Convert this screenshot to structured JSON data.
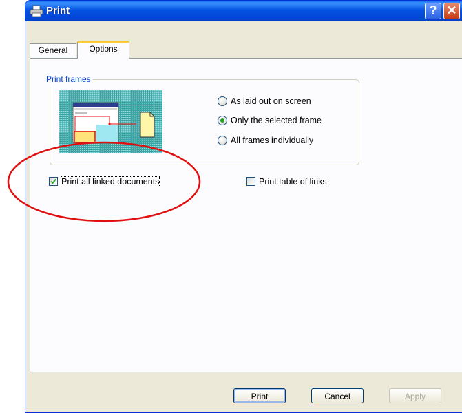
{
  "window": {
    "title": "Print",
    "icon": "printer-icon",
    "help_label": "?",
    "close_label": "✕"
  },
  "tabs": [
    {
      "label": "General",
      "selected": false
    },
    {
      "label": "Options",
      "selected": true
    }
  ],
  "print_frames": {
    "legend": "Print frames",
    "options": [
      {
        "label": "As laid out on screen",
        "selected": false
      },
      {
        "label": "Only the selected frame",
        "selected": true
      },
      {
        "label": "All frames individually",
        "selected": false
      }
    ]
  },
  "checkboxes": {
    "print_linked": {
      "label": "Print all linked documents",
      "checked": true
    },
    "print_table": {
      "label": "Print table of links",
      "checked": false
    }
  },
  "buttons": {
    "print": "Print",
    "cancel": "Cancel",
    "apply": "Apply"
  },
  "colors": {
    "titlebar": "#0553e1",
    "annotation": "#e01010",
    "group_legend": "#0046d5",
    "radio_dot": "#21a121",
    "checkmark": "#21a121"
  }
}
